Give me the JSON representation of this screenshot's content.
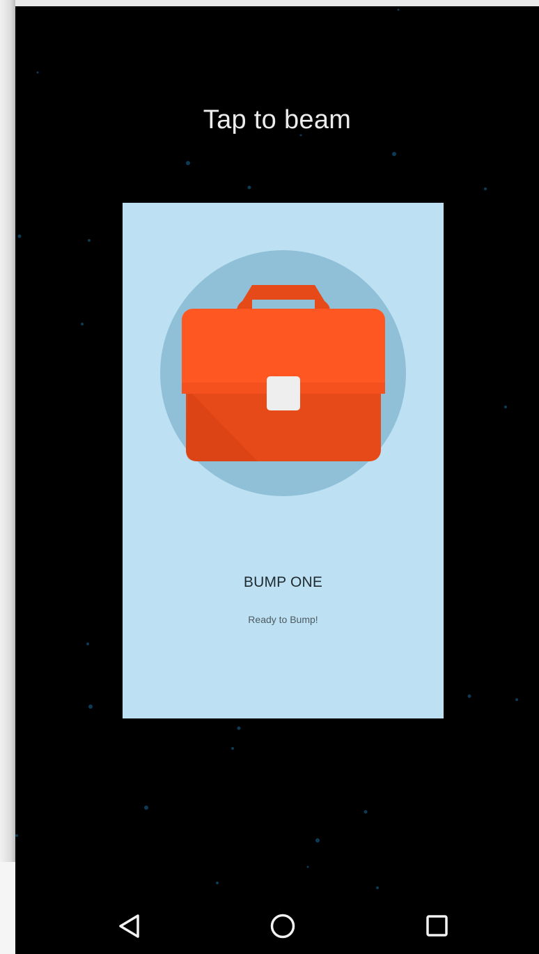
{
  "header": {
    "title": "Tap to beam"
  },
  "card": {
    "name": "BUMP ONE",
    "status": "Ready to Bump!",
    "illustration_icon": "briefcase-icon",
    "colors": {
      "card_background": "#bde1f3",
      "circle": "#8fc0d8",
      "briefcase": "#ff5722",
      "briefcase_dark": "#e64a19",
      "clasp": "#eeeeee"
    }
  },
  "navbar": {
    "back_icon": "back-triangle-icon",
    "home_icon": "home-circle-icon",
    "recents_icon": "recents-square-icon"
  },
  "colors": {
    "screen_background": "#000000",
    "star": "#0f3a55"
  }
}
